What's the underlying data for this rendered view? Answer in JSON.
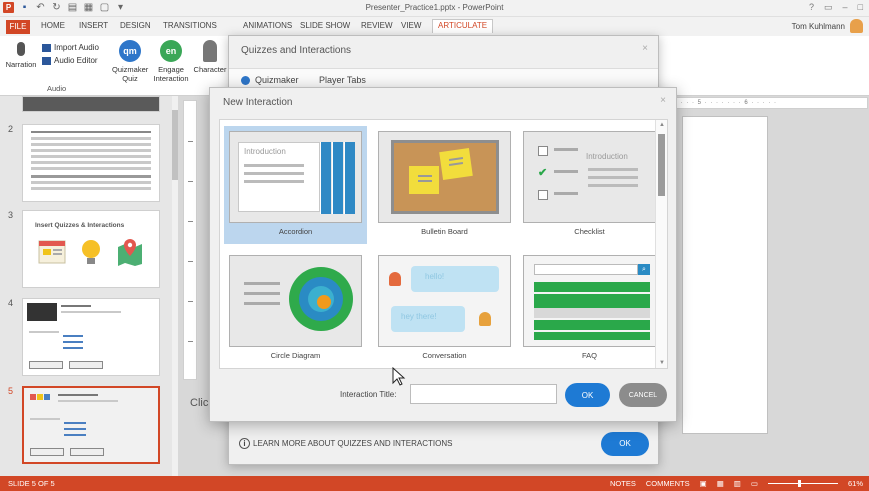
{
  "window": {
    "title": "Presenter_Practice1.pptx - PowerPoint",
    "controls": [
      "?",
      "▭",
      "–",
      "□"
    ]
  },
  "ribbon_tabs": {
    "file": "FILE",
    "tabs": [
      "HOME",
      "INSERT",
      "DESIGN",
      "TRANSITIONS",
      "ANIMATIONS",
      "SLIDE SHOW",
      "REVIEW",
      "VIEW",
      "ARTICULATE"
    ],
    "active": "ARTICULATE",
    "user": "Tom Kuhlmann"
  },
  "ribbon": {
    "narration": "Narration",
    "import_audio": "Import Audio",
    "audio_editor": "Audio Editor",
    "quizmaker": [
      "Quizmaker",
      "Quiz"
    ],
    "engage": [
      "Engage",
      "Interaction"
    ],
    "character": "Character",
    "audio_group": "Audio"
  },
  "thumbnails": {
    "numbers": [
      "2",
      "3",
      "4",
      "5"
    ],
    "slide3_title": "Insert Quizzes & Interactions",
    "selected_index": 4
  },
  "slide": {
    "click_text": "Click",
    "ruler": "· · · · 5 · · · · · · · 6 · · · · ·"
  },
  "status": {
    "slide": "SLIDE 5 OF 5",
    "notes": "NOTES",
    "comments": "COMMENTS",
    "zoom": "61%"
  },
  "quizzes_dialog": {
    "title": "Quizzes and Interactions",
    "close": "×",
    "tabs": [
      "Quizmaker",
      "Player Tabs"
    ],
    "learn_more": "LEARN MORE ABOUT QUIZZES AND INTERACTIONS",
    "ok": "OK"
  },
  "new_interaction": {
    "title": "New Interaction",
    "close": "×",
    "items": [
      {
        "label": "Accordion"
      },
      {
        "label": "Bulletin Board"
      },
      {
        "label": "Checklist"
      },
      {
        "label": "Circle Diagram"
      },
      {
        "label": "Conversation"
      },
      {
        "label": "FAQ"
      }
    ],
    "selected": "Accordion",
    "preview_text": {
      "accordion": "Introduction",
      "checklist": "Introduction",
      "hello": "hello!",
      "hey_there": "hey there!"
    },
    "title_label": "Interaction Title:",
    "title_value": "",
    "ok": "OK",
    "cancel": "CANCEL"
  },
  "colors": {
    "accent": "#d24726",
    "primary_button": "#1e7ad4",
    "selection": "#bcd6ee"
  }
}
